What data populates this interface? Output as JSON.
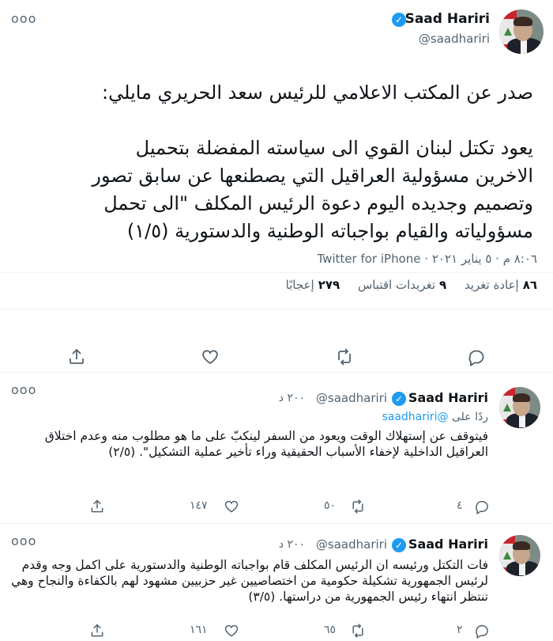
{
  "main": {
    "author": {
      "name": "Saad Hariri",
      "handle": "@saadhariri"
    },
    "more_label": "ooo",
    "paragraphs": [
      "صدر عن المكتب الاعلامي للرئيس سعد الحريري مايلي:",
      "يعود تكتل لبنان القوي الى سياسته المفضلة بتحميل الاخرين مسؤولية العراقيل التي يصطنعها عن سابق تصور وتصميم وجديده اليوم دعوة الرئيس المكلف \"الى تحمل مسؤولياته والقيام بواجباته الوطنية والدستورية (١/٥)"
    ],
    "timestamp": "٨:٠٦ م · ٥ يناير ٢٠٢١ ·",
    "source": "Twitter for iPhone",
    "stats": [
      {
        "count": "٨٦",
        "label": "إعادة تغريد"
      },
      {
        "count": "٩",
        "label": "تغريدات اقتباس"
      },
      {
        "count": "٢٧٩",
        "label": "إعجابًا"
      }
    ]
  },
  "replies": [
    {
      "author": {
        "name": "Saad Hariri",
        "handle": "@saadhariri"
      },
      "time": "٢٠٠ د",
      "replying_prefix": "ردًا على",
      "replying_to": "@saadhariri",
      "text": "فيتوقف عن إستهلاك الوقت ويعود من السفر لينكبّ على ما هو مطلوب منه وعدم اختلاق العراقيل الداخلية لإخفاء الأسباب الحقيقية وراء تأخير عملية التشكيل\". (٢/٥)",
      "reply_count": "٤",
      "retweet_count": "٥٠",
      "like_count": "١٤٧"
    },
    {
      "author": {
        "name": "Saad Hariri",
        "handle": "@saadhariri"
      },
      "time": "٢٠٠ د",
      "text": "فات التكتل ورئيسه ان الرئيس المكلف قام بواجباته الوطنية والدستورية على اكمل وجه وقدم لرئيس الجمهورية تشكيلة حكومية من اختصاصيين غير حزبيين مشهود لهم بالكفاءة والنجاح وهي تنتظر انتهاء رئيس الجمهورية من دراستها. (٣/٥)",
      "reply_count": "٢",
      "retweet_count": "٦٥",
      "like_count": "١٦١"
    }
  ],
  "colors": {
    "accent": "#1d9bf0",
    "muted": "#536471",
    "text": "#0f1419",
    "divider": "#eff3f4"
  }
}
